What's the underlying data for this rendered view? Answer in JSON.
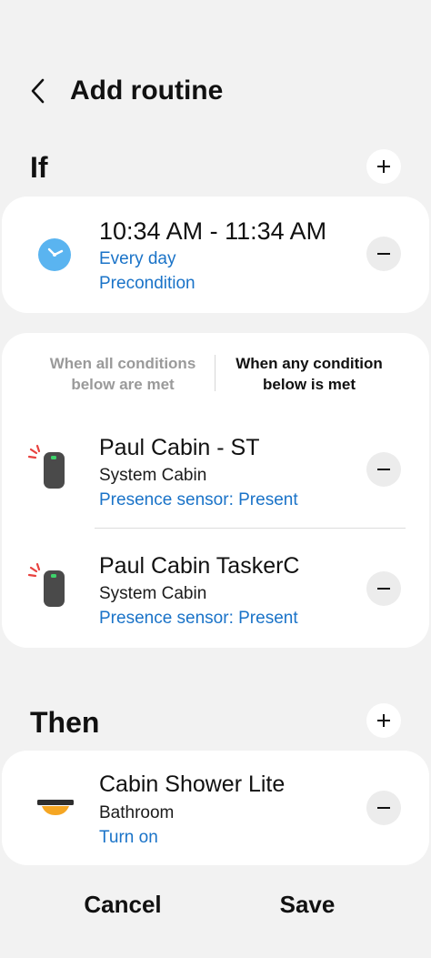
{
  "header": {
    "title": "Add routine",
    "back_icon": "chevron-left-icon"
  },
  "if_section": {
    "title": "If",
    "time_condition": {
      "time_range": "10:34 AM - 11:34 AM",
      "repeat": "Every day",
      "precondition": "Precondition",
      "icon": "clock-icon"
    },
    "condition_mode": {
      "all_label": "When all conditions below are met",
      "any_label": "When any condition below is met",
      "selected": "any"
    },
    "devices": [
      {
        "name": "Paul Cabin - ST",
        "location": "System Cabin",
        "state": "Presence sensor: Present",
        "icon": "presence-sensor-icon"
      },
      {
        "name": "Paul Cabin TaskerC",
        "location": "System Cabin",
        "state": "Presence sensor: Present",
        "icon": "presence-sensor-icon"
      }
    ]
  },
  "then_section": {
    "title": "Then",
    "actions": [
      {
        "name": "Cabin Shower Lite",
        "location": "Bathroom",
        "action": "Turn on",
        "icon": "ceiling-light-icon"
      }
    ]
  },
  "footer": {
    "cancel_label": "Cancel",
    "save_label": "Save"
  },
  "colors": {
    "background": "#f2f2f2",
    "card": "#ffffff",
    "link_blue": "#1a73c8",
    "clock_blue": "#5ab4f0",
    "sensor_green": "#3dd36b",
    "sensor_red": "#e8423f",
    "light_orange": "#f5a623"
  }
}
